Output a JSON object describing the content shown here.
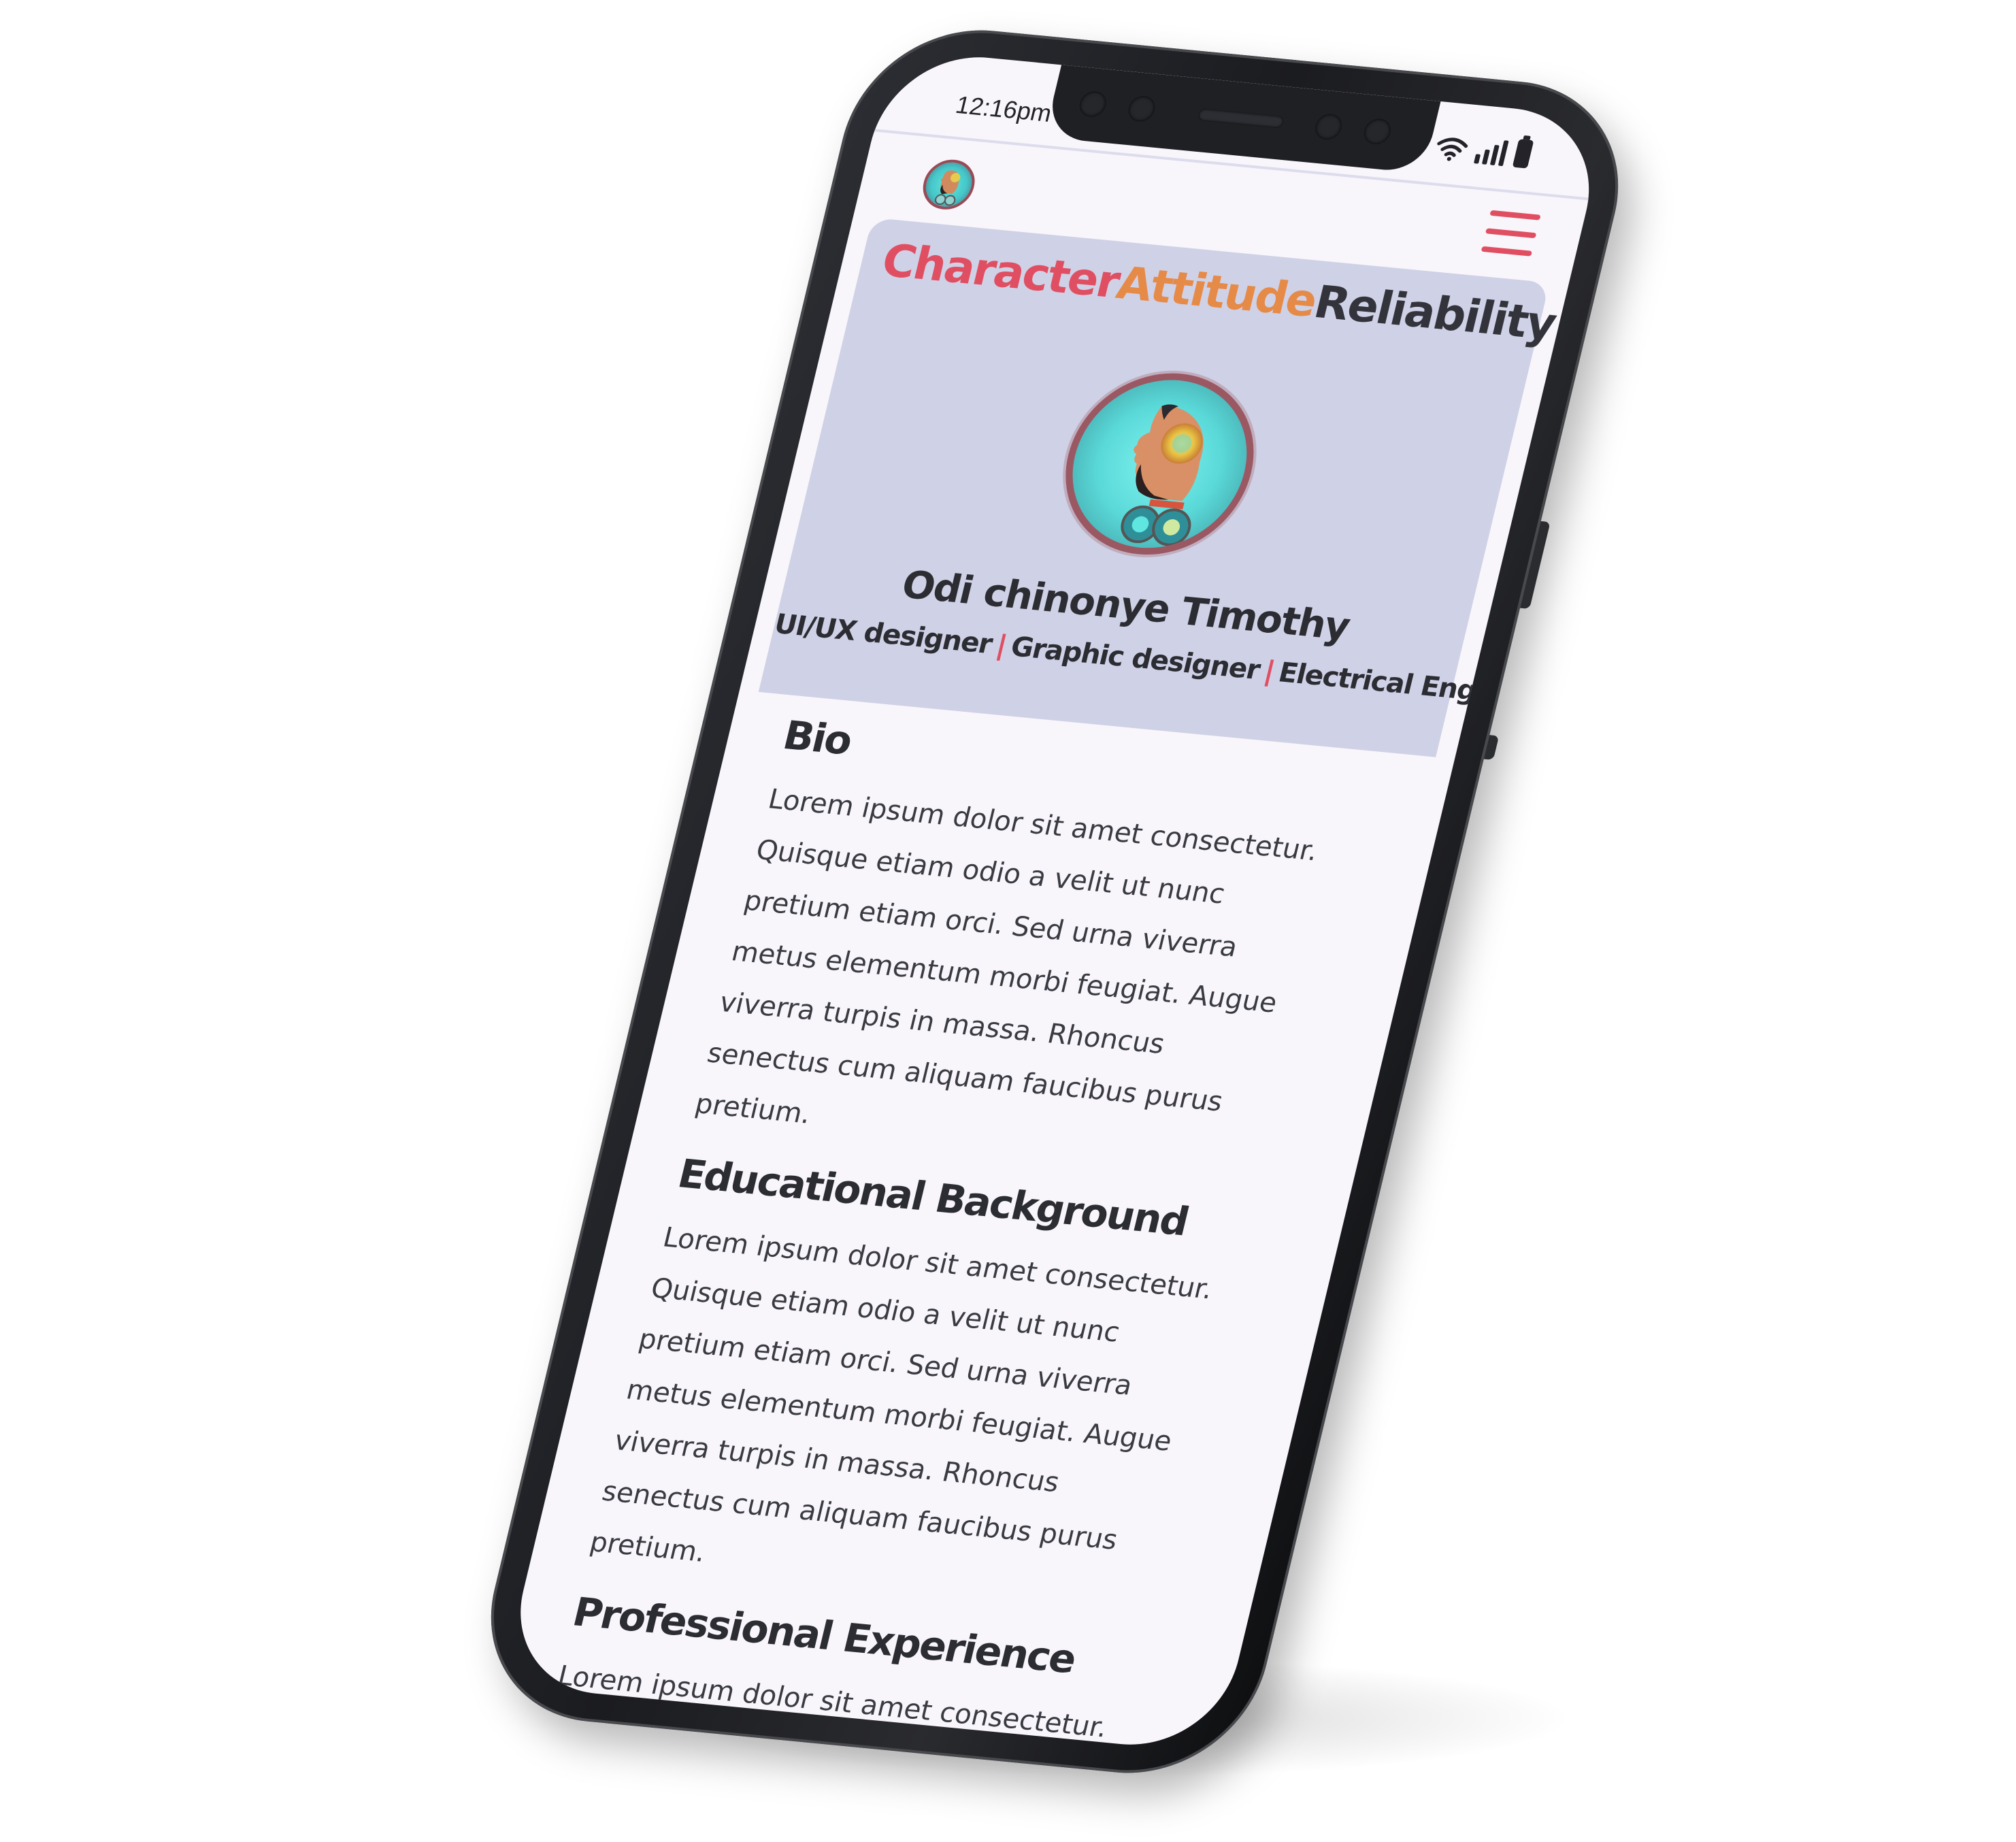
{
  "status_bar": {
    "time": "12:16pm",
    "icons": [
      "wifi-icon",
      "signal-icon",
      "battery-icon"
    ]
  },
  "header": {
    "logo_icon": "avatar-logo",
    "menu_icon": "hamburger-menu-icon"
  },
  "hero": {
    "tagline": {
      "word1": "Character",
      "word2": "Attitude",
      "word3": "Reliability"
    },
    "name": "Odi chinonye Timothy",
    "roles": {
      "role1": "UI/UX designer",
      "role2": "Graphic designer",
      "role3": "Electrical Engr.",
      "separator": "|"
    }
  },
  "sections": {
    "bio": {
      "title": "Bio",
      "body": "Lorem ipsum dolor sit amet consectetur. Quisque etiam odio a velit ut nunc pretium etiam orci. Sed urna viverra metus elementum morbi feugiat. Augue viverra turpis in massa. Rhoncus senectus cum aliquam faucibus purus pretium."
    },
    "education": {
      "title": "Educational Background",
      "body": "Lorem ipsum dolor sit amet consectetur. Quisque etiam odio a velit ut nunc pretium etiam orci. Sed urna viverra metus elementum morbi feugiat. Augue viverra turpis in massa. Rhoncus senectus cum aliquam faucibus purus pretium."
    },
    "experience": {
      "title": "Professional Experience",
      "body": "Lorem ipsum dolor sit amet consectetur."
    }
  },
  "colors": {
    "accent_red": "#e04e62",
    "accent_orange": "#e68a48",
    "text_dark": "#33343b",
    "hero_bg": "#cfd1e6",
    "screen_bg": "#f8f6fb",
    "avatar_teal": "#5ad9d9"
  }
}
